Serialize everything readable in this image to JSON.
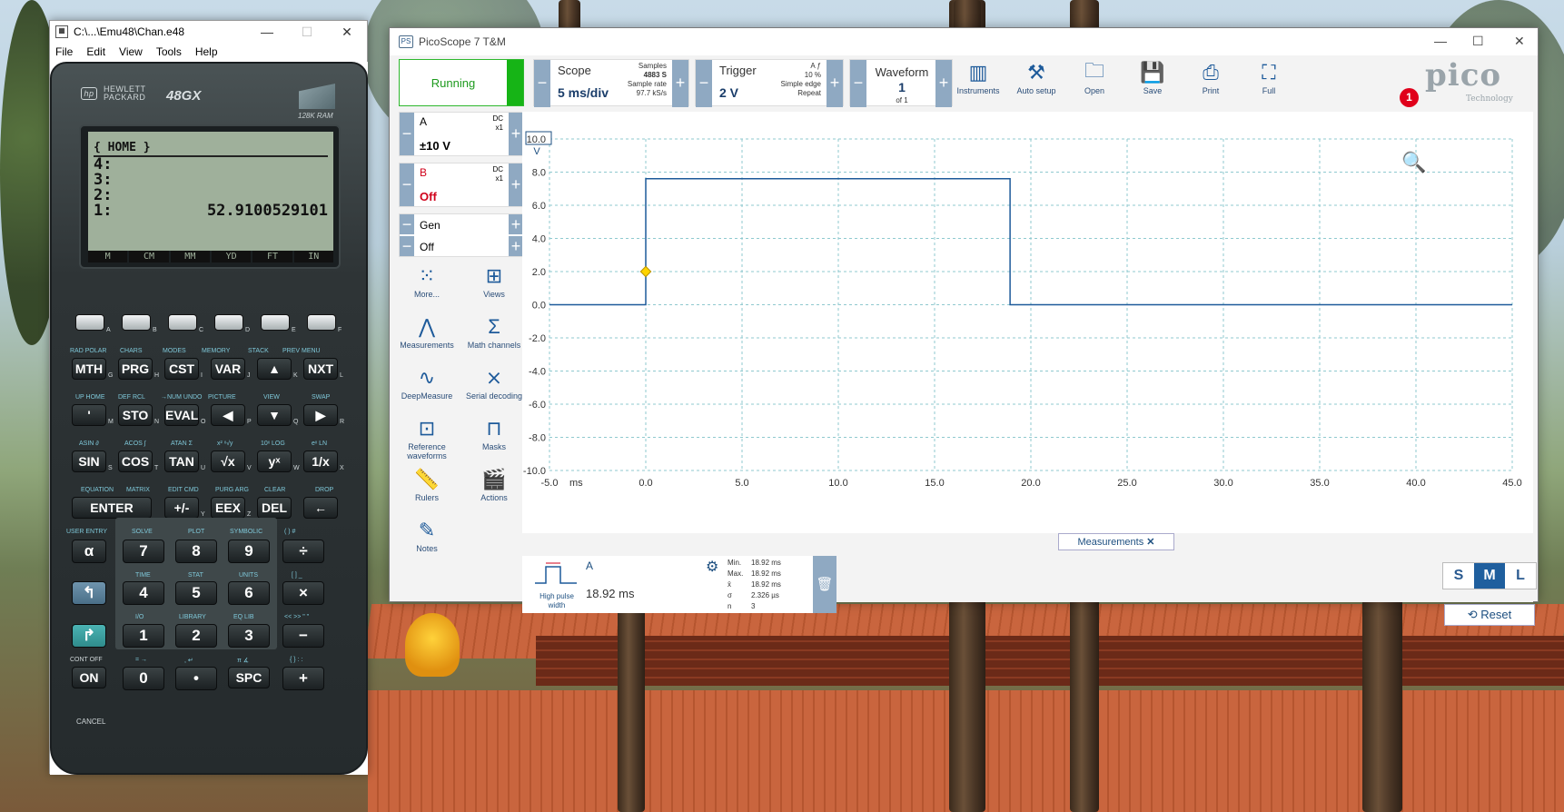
{
  "calc_window": {
    "title": "C:\\...\\Emu48\\Chan.e48",
    "menu": [
      "File",
      "Edit",
      "View",
      "Tools",
      "Help"
    ],
    "brand_line1": "HEWLETT",
    "brand_line2": "PACKARD",
    "model": "48GX",
    "ram": "128K RAM",
    "lcd": {
      "header": "{ HOME }",
      "stack": [
        {
          "level": "4:",
          "value": ""
        },
        {
          "level": "3:",
          "value": ""
        },
        {
          "level": "2:",
          "value": ""
        },
        {
          "level": "1:",
          "value": "52.9100529101"
        }
      ],
      "menu_keys": [
        "M",
        "CM",
        "MM",
        "YD",
        "FT",
        "IN"
      ]
    },
    "softkey_letters": [
      "A",
      "B",
      "C",
      "D",
      "E",
      "F"
    ],
    "row_labels": [
      [
        "RAD POLAR",
        "CHARS",
        "MODES",
        "MEMORY",
        "STACK",
        "PREV MENU"
      ],
      [
        "UP HOME",
        "DEF RCL",
        "→NUM UNDO",
        "PICTURE",
        "VIEW",
        "SWAP"
      ],
      [
        "ASIN ∂",
        "ACOS ∫",
        "ATAN Σ",
        "x² ˣ√y",
        "10ˣ LOG",
        "eˣ LN"
      ],
      [
        "EQUATION",
        "MATRIX",
        "EDIT CMD",
        "PURG ARG",
        "CLEAR",
        "DROP"
      ]
    ],
    "keys_row1": [
      "MTH",
      "PRG",
      "CST",
      "VAR",
      "▲",
      "NXT"
    ],
    "keys_row2": [
      "'",
      "STO",
      "EVAL",
      "◀",
      "▼",
      "▶"
    ],
    "keys_row3": [
      "SIN",
      "COS",
      "TAN",
      "√x",
      "yˣ",
      "1/x"
    ],
    "keys_row4": [
      "ENTER",
      "+/-",
      "EEX",
      "DEL",
      "←"
    ],
    "letters_row1": [
      "G",
      "H",
      "I",
      "J",
      "K",
      "L"
    ],
    "letters_row2": [
      "M",
      "N",
      "O",
      "P",
      "Q",
      "R"
    ],
    "letters_row3": [
      "S",
      "T",
      "U",
      "V",
      "W",
      "X"
    ],
    "letters_row4": [
      "Y",
      "Z"
    ],
    "num_labels": {
      "r5": [
        "USER ENTRY",
        "SOLVE",
        "PLOT",
        "SYMBOLIC",
        "( ) #"
      ],
      "r6": [
        "TIME",
        "STAT",
        "UNITS",
        "[ ] _"
      ],
      "r7": [
        "I/O",
        "LIBRARY",
        "EQ LIB",
        "<< >> \" \""
      ],
      "r8": [
        "CONT OFF",
        "= →",
        ", ↵",
        "π ∡",
        "{ } : :"
      ]
    },
    "num_keys": {
      "r5": [
        "α",
        "7",
        "8",
        "9",
        "÷"
      ],
      "r6": [
        "↰",
        "4",
        "5",
        "6",
        "×"
      ],
      "r7": [
        "↱",
        "1",
        "2",
        "3",
        "−"
      ],
      "r8": [
        "ON",
        "0",
        "•",
        "SPC",
        "+"
      ]
    },
    "cancel": "CANCEL"
  },
  "pico": {
    "title": "PicoScope 7 T&M",
    "title_icon": "PS",
    "status": "Running",
    "scope": {
      "label": "Scope",
      "value": "5 ms/div",
      "samples_label": "Samples",
      "samples": "4883 S",
      "rate_label": "Sample rate",
      "rate": "97.7 kS/s"
    },
    "trigger": {
      "label": "Trigger",
      "value": "2 V",
      "channel": "A ƒ",
      "percent": "10 %",
      "type": "Simple edge",
      "mode": "Repeat"
    },
    "waveform": {
      "label": "Waveform",
      "value": "1",
      "of": "of 1"
    },
    "tools": [
      "Instruments",
      "Auto setup",
      "Open",
      "Save",
      "Print",
      "Full"
    ],
    "logo": "pico",
    "logo_sub": "Technology",
    "notification_count": "1",
    "channels": [
      {
        "name": "A",
        "range": "±10 V",
        "coupling": "DC",
        "probe": "x1",
        "color": "#1d4f80"
      },
      {
        "name": "B",
        "range": "Off",
        "coupling": "DC",
        "probe": "x1",
        "color": "#d0021b"
      }
    ],
    "gen": {
      "name": "Gen",
      "state": "Off"
    },
    "side_tools": [
      {
        "icon": "more-icon",
        "label": "More..."
      },
      {
        "icon": "views-icon",
        "label": "Views"
      },
      {
        "icon": "measurements-icon",
        "label": "Measurements"
      },
      {
        "icon": "math-channels-icon",
        "label": "Math channels"
      },
      {
        "icon": "deepmeasure-icon",
        "label": "DeepMeasure"
      },
      {
        "icon": "serial-decoding-icon",
        "label": "Serial decoding"
      },
      {
        "icon": "reference-waveforms-icon",
        "label": "Reference waveforms"
      },
      {
        "icon": "masks-icon",
        "label": "Masks"
      },
      {
        "icon": "rulers-icon",
        "label": "Rulers"
      },
      {
        "icon": "actions-icon",
        "label": "Actions"
      },
      {
        "icon": "notes-icon",
        "label": "Notes"
      }
    ],
    "measurements_tab": "Measurements",
    "measurement": {
      "channel": "A",
      "name": "High pulse width",
      "value": "18.92 ms",
      "stats": [
        {
          "k": "Min.",
          "v": "18.92 ms"
        },
        {
          "k": "Max.",
          "v": "18.92 ms"
        },
        {
          "k": "x̄",
          "v": "18.92 ms"
        },
        {
          "k": "σ",
          "v": "2.326 µs"
        },
        {
          "k": "n",
          "v": "3"
        }
      ]
    },
    "size_buttons": [
      "S",
      "M",
      "L"
    ],
    "size_selected": "M",
    "reset": "Reset"
  },
  "chart_data": {
    "type": "line",
    "title": "",
    "xlabel": "ms",
    "ylabel": "V",
    "xlim": [
      -5.0,
      45.0
    ],
    "ylim": [
      -10.0,
      10.0
    ],
    "x_ticks": [
      "-5.0",
      "0.0",
      "5.0",
      "10.0",
      "15.0",
      "20.0",
      "25.0",
      "30.0",
      "35.0",
      "40.0",
      "45.0"
    ],
    "y_ticks": [
      "10.0",
      "8.0",
      "6.0",
      "4.0",
      "2.0",
      "0.0",
      "-2.0",
      "-4.0",
      "-6.0",
      "-8.0",
      "-10.0"
    ],
    "grid": true,
    "trigger_level": 2.0,
    "trigger_time": 0.0,
    "series": [
      {
        "name": "A",
        "color": "#1d5a9a",
        "x": [
          -5.0,
          0.0,
          0.0,
          18.92,
          18.92,
          45.0
        ],
        "y": [
          0.0,
          0.0,
          7.6,
          7.6,
          0.0,
          0.0
        ]
      }
    ]
  }
}
